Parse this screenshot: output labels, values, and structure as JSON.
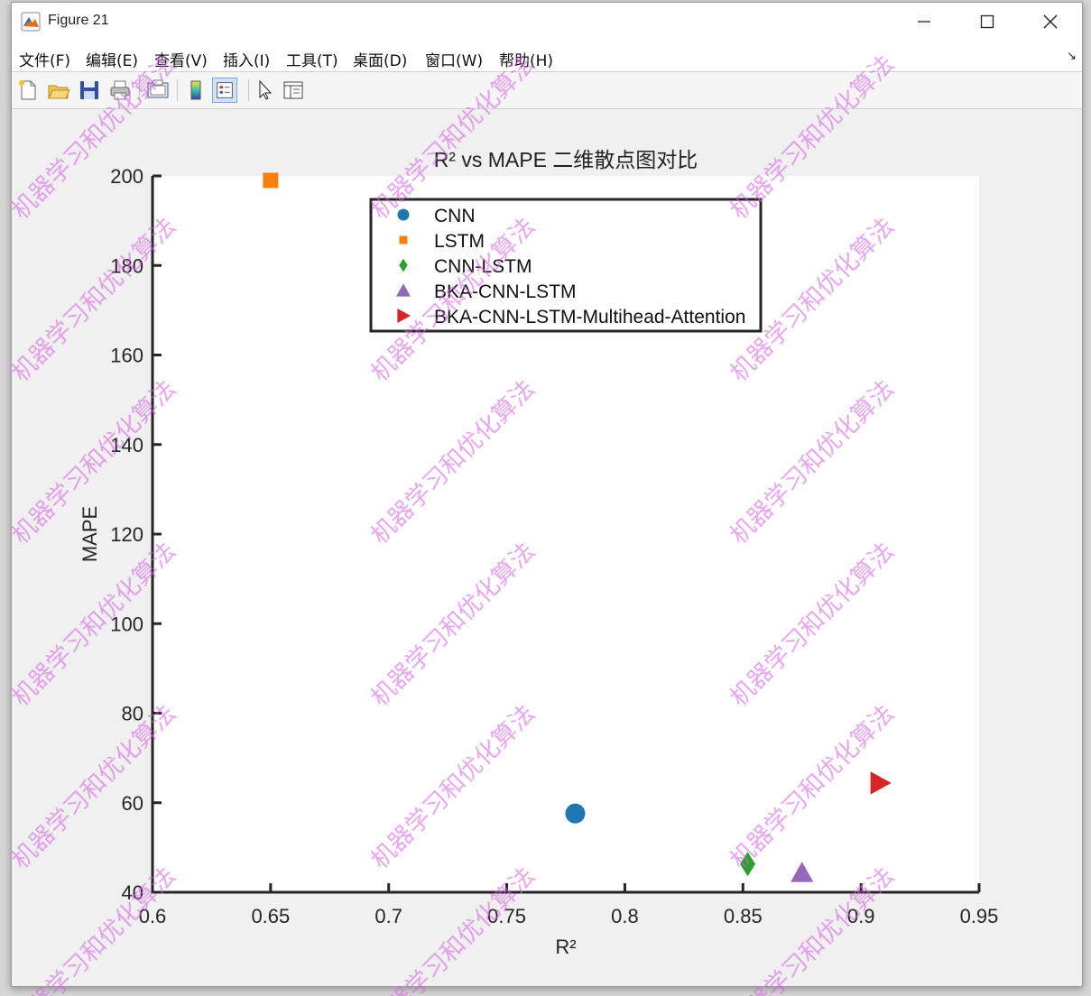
{
  "window": {
    "title": "Figure 21",
    "minimize": "—",
    "maximize": "☐",
    "close": "✕"
  },
  "menu": [
    "文件(F)",
    "编辑(E)",
    "查看(V)",
    "插入(I)",
    "工具(T)",
    "桌面(D)",
    "窗口(W)",
    "帮助(H)"
  ],
  "menu_extra": "↘",
  "toolbar": {
    "buttons": [
      "new-figure-icon",
      "open-folder-icon",
      "save-icon",
      "print-icon",
      "print-preview-icon",
      "colorbar-icon",
      "legend-icon",
      "pointer-icon",
      "property-inspector-icon"
    ],
    "active": "legend-icon"
  },
  "watermark": "机器学习和优化算法",
  "colors": {
    "CNN": "#1f77b4",
    "LSTM": "#ff7f0e",
    "CNN-LSTM": "#2ca02c",
    "BKA-CNN-LSTM": "#9467bd",
    "BKA-CNN-LSTM-Multihead-Attention": "#d62728"
  },
  "chart_data": {
    "type": "scatter",
    "title": "R² vs MAPE 二维散点图对比",
    "xlabel": "R²",
    "ylabel": "MAPE",
    "xlim": [
      0.6,
      0.95
    ],
    "ylim": [
      40,
      200
    ],
    "xticks": [
      "0.6",
      "0.65",
      "0.7",
      "0.75",
      "0.8",
      "0.85",
      "0.9",
      "0.95"
    ],
    "yticks": [
      "40",
      "60",
      "80",
      "100",
      "120",
      "140",
      "160",
      "180",
      "200"
    ],
    "legend_position": "top-center",
    "grid": false,
    "series": [
      {
        "name": "CNN",
        "marker": "circle",
        "x": 0.779,
        "y": 57.6
      },
      {
        "name": "LSTM",
        "marker": "square",
        "x": 0.65,
        "y": 199
      },
      {
        "name": "CNN-LSTM",
        "marker": "diamond",
        "x": 0.852,
        "y": 46.3
      },
      {
        "name": "BKA-CNN-LSTM",
        "marker": "triangle-up",
        "x": 0.875,
        "y": 44.4
      },
      {
        "name": "BKA-CNN-LSTM-Multihead-Attention",
        "marker": "triangle-right",
        "x": 0.908,
        "y": 64.4
      }
    ]
  }
}
